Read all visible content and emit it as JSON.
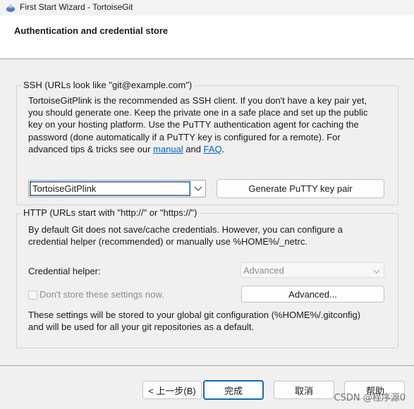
{
  "window": {
    "title": "First Start Wizard - TortoiseGit"
  },
  "header": {
    "title": "Authentication and credential store"
  },
  "ssh": {
    "legend": "SSH (URLs look like \"git@example.com\")",
    "lines": [
      "TortoiseGitPlink is the recommended as SSH client. If you don't have a key pair yet,",
      "you should generate one. Keep the private one in a safe place and set up the public",
      "key on your hosting platform. Use the PuTTY authentication agent for caching the",
      "password (done automatically if a PuTTY key is configured for a remote). For"
    ],
    "line5_prefix": "advanced tips & tricks see our ",
    "manual_link": "manual",
    "line5_mid": " and ",
    "faq_link": "FAQ",
    "line5_suffix": ".",
    "client_select": "TortoiseGitPlink",
    "generate_button": "Generate PuTTY  key pair"
  },
  "http": {
    "legend": "HTTP (URLs start with \"http://\" or \"https://\")",
    "desc_lines": [
      "By default Git does not save/cache credentials. However, you can configure a",
      "credential helper (recommended) or manually use %HOME%/_netrc."
    ],
    "helper_label": "Credential helper:",
    "helper_value": "Advanced",
    "dont_store_label": "Don't store these settings now.",
    "advanced_button": "Advanced...",
    "note_lines": [
      "These settings will be stored to your global git configuration (%HOME%/.gitconfig)",
      "and will be used for all your git repositories as a default."
    ]
  },
  "footer": {
    "back_button": "< 上一步(B)",
    "finish_button": "完成",
    "cancel_button": "取消",
    "help_button": "帮助"
  },
  "watermark": "CSDN @程序源0"
}
